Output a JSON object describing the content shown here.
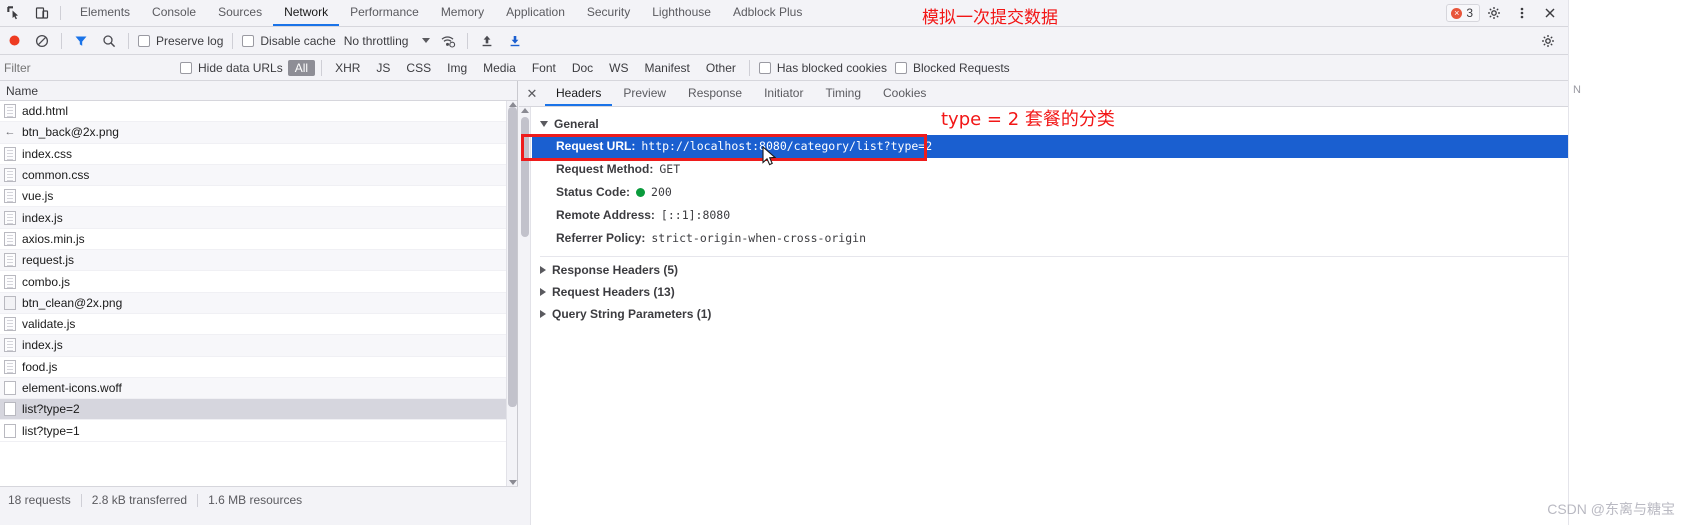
{
  "tabbar": {
    "inspect_icon": "inspect-element-icon",
    "device_icon": "device-toolbar-icon",
    "tabs": [
      {
        "label": "Elements",
        "selected": false
      },
      {
        "label": "Console",
        "selected": false
      },
      {
        "label": "Sources",
        "selected": false
      },
      {
        "label": "Network",
        "selected": true
      },
      {
        "label": "Performance",
        "selected": false
      },
      {
        "label": "Memory",
        "selected": false
      },
      {
        "label": "Application",
        "selected": false
      },
      {
        "label": "Security",
        "selected": false
      },
      {
        "label": "Lighthouse",
        "selected": false
      },
      {
        "label": "Adblock Plus",
        "selected": false
      }
    ],
    "error_count": "3",
    "settings_icon": "gear-icon",
    "more_icon": "more-vertical-icon",
    "close_icon": "close-icon"
  },
  "network_toolbar": {
    "record_label": "record-button",
    "clear_label": "clear-button",
    "filter_label": "filter-button",
    "search_label": "search-button",
    "preserve_log": "Preserve log",
    "disable_cache": "Disable cache",
    "throttling": "No throttling",
    "wifi_icon": "network-conditions-icon",
    "import_icon": "import-har-icon",
    "export_icon": "export-har-icon",
    "settings_icon": "network-settings-icon"
  },
  "filter_bar": {
    "placeholder": "Filter",
    "value": "",
    "hide_data_urls": "Hide data URLs",
    "chips": [
      {
        "label": "All",
        "selected": true
      },
      {
        "label": "XHR",
        "selected": false
      },
      {
        "label": "JS",
        "selected": false
      },
      {
        "label": "CSS",
        "selected": false
      },
      {
        "label": "Img",
        "selected": false
      },
      {
        "label": "Media",
        "selected": false
      },
      {
        "label": "Font",
        "selected": false
      },
      {
        "label": "Doc",
        "selected": false
      },
      {
        "label": "WS",
        "selected": false
      },
      {
        "label": "Manifest",
        "selected": false
      },
      {
        "label": "Other",
        "selected": false
      }
    ],
    "has_blocked_cookies": "Has blocked cookies",
    "blocked_requests": "Blocked Requests"
  },
  "request_list": {
    "column_header": "Name",
    "rows": [
      {
        "name": "add.html",
        "icon": "doc",
        "selected": false
      },
      {
        "name": "btn_back@2x.png",
        "icon": "arrow",
        "selected": false
      },
      {
        "name": "index.css",
        "icon": "doc",
        "selected": false
      },
      {
        "name": "common.css",
        "icon": "doc",
        "selected": false
      },
      {
        "name": "vue.js",
        "icon": "doc",
        "selected": false
      },
      {
        "name": "index.js",
        "icon": "doc",
        "selected": false
      },
      {
        "name": "axios.min.js",
        "icon": "doc",
        "selected": false
      },
      {
        "name": "request.js",
        "icon": "doc",
        "selected": false
      },
      {
        "name": "combo.js",
        "icon": "doc",
        "selected": false
      },
      {
        "name": "btn_clean@2x.png",
        "icon": "img",
        "selected": false
      },
      {
        "name": "validate.js",
        "icon": "doc",
        "selected": false
      },
      {
        "name": "index.js",
        "icon": "doc",
        "selected": false
      },
      {
        "name": "food.js",
        "icon": "doc",
        "selected": false
      },
      {
        "name": "element-icons.woff",
        "icon": "plain",
        "selected": false
      },
      {
        "name": "list?type=2",
        "icon": "plain",
        "selected": true
      },
      {
        "name": "list?type=1",
        "icon": "plain",
        "selected": false
      }
    ]
  },
  "status_bar": {
    "requests": "18 requests",
    "transferred": "2.8 kB transferred",
    "resources": "1.6 MB resources"
  },
  "detail_panel": {
    "close_icon": "close-icon",
    "tabs": [
      {
        "label": "Headers",
        "selected": true
      },
      {
        "label": "Preview",
        "selected": false
      },
      {
        "label": "Response",
        "selected": false
      },
      {
        "label": "Initiator",
        "selected": false
      },
      {
        "label": "Timing",
        "selected": false
      },
      {
        "label": "Cookies",
        "selected": false
      }
    ],
    "general": {
      "title": "General",
      "request_url_key": "Request URL:",
      "request_url_value": "http://localhost:8080/category/list?type=2",
      "request_method_key": "Request Method:",
      "request_method_value": "GET",
      "status_code_key": "Status Code:",
      "status_code_value": "200",
      "remote_address_key": "Remote Address:",
      "remote_address_value": "[::1]:8080",
      "referrer_policy_key": "Referrer Policy:",
      "referrer_policy_value": "strict-origin-when-cross-origin"
    },
    "sections": [
      {
        "label": "Response Headers (5)"
      },
      {
        "label": "Request Headers (13)"
      },
      {
        "label": "Query String Parameters (1)"
      }
    ]
  },
  "annotations": {
    "top": "模拟一次提交数据",
    "detail": "type = 2 套餐的分类",
    "highlight_color": "#ee1c1c"
  },
  "watermark": "CSDN @东离与糖宝",
  "gutter_mark": "N"
}
